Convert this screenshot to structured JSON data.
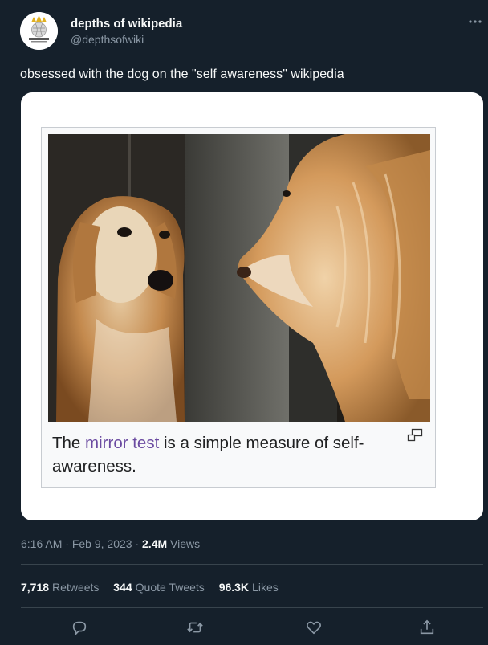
{
  "author": {
    "name": "depths of wikipedia",
    "handle": "@depthsofwiki",
    "avatar_icon": "wikipedia-globe-logo"
  },
  "tweet": {
    "text": "obsessed with the dog on the \"self awareness\" wikipedia"
  },
  "media": {
    "caption_prefix": "The ",
    "caption_link": "mirror test",
    "caption_suffix": " is a simple measure of self-awareness.",
    "link_color": "#6b4ba1",
    "image_icon": "dog-looking-in-mirror-photo",
    "enlarge_icon": "enlarge-icon"
  },
  "meta": {
    "time": "6:16 AM",
    "sep": " · ",
    "date": "Feb 9, 2023",
    "views_count": "2.4M",
    "views_label": "Views"
  },
  "stats": {
    "retweets_count": "7,718",
    "retweets_label": "Retweets",
    "quotes_count": "344",
    "quotes_label": "Quote Tweets",
    "likes_count": "96.3K",
    "likes_label": "Likes"
  },
  "actions": [
    "reply-icon",
    "retweet-icon",
    "like-icon",
    "share-icon"
  ],
  "colors": {
    "background": "#15202b",
    "secondary_text": "#8b98a5",
    "divider": "#38444d"
  }
}
